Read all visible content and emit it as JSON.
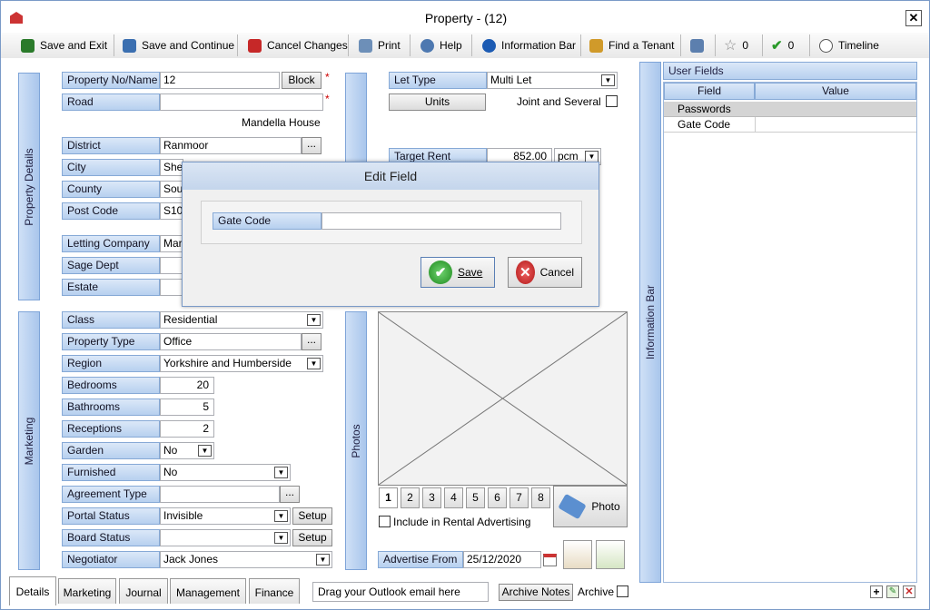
{
  "window": {
    "title": "Property  - (12)",
    "close_glyph": "✕"
  },
  "toolbar": {
    "save_exit": "Save and Exit",
    "save_continue": "Save and Continue",
    "cancel_changes": "Cancel Changes",
    "print": "Print",
    "help": "Help",
    "information_bar": "Information Bar",
    "find_tenant": "Find a Tenant",
    "star_count": "0",
    "tick_count": "0",
    "timeline": "Timeline"
  },
  "side": {
    "property_details": "Property Details",
    "marketing": "Marketing",
    "photos": "Photos",
    "information_bar": "Information Bar"
  },
  "details": {
    "property_no_label": "Property No/Name",
    "property_no": "12",
    "block_btn": "Block",
    "road_label": "Road",
    "road": "",
    "house_name": "Mandella House",
    "district_label": "District",
    "district": "Ranmoor",
    "city_label": "City",
    "city": "Shef",
    "county_label": "County",
    "county": "South",
    "postcode_label": "Post Code",
    "postcode": "S10",
    "letting_company_label": "Letting Company",
    "letting_company": "Mar",
    "sage_dept_label": "Sage Dept",
    "sage_dept": "",
    "estate_label": "Estate",
    "estate": "",
    "dots": "...",
    "required": "*"
  },
  "let": {
    "let_type_label": "Let Type",
    "let_type": "Multi Let",
    "units_btn": "Units",
    "joint_several": "Joint and Several",
    "target_rent_label": "Target Rent",
    "target_rent": "852.00",
    "period": "pcm"
  },
  "marketing": {
    "class_label": "Class",
    "class": "Residential",
    "property_type_label": "Property Type",
    "property_type": "Office",
    "region_label": "Region",
    "region": "Yorkshire and Humberside",
    "bedrooms_label": "Bedrooms",
    "bedrooms": "20",
    "bathrooms_label": "Bathrooms",
    "bathrooms": "5",
    "receptions_label": "Receptions",
    "receptions": "2",
    "garden_label": "Garden",
    "garden": "No",
    "furnished_label": "Furnished",
    "furnished": "No",
    "agreement_type_label": "Agreement Type",
    "agreement_type": "",
    "portal_status_label": "Portal Status",
    "portal_status": "Invisible",
    "board_status_label": "Board Status",
    "board_status": "",
    "negotiator_label": "Negotiator",
    "negotiator": "Jack Jones",
    "setup_btn": "Setup"
  },
  "photos": {
    "pages": [
      "1",
      "2",
      "3",
      "4",
      "5",
      "6",
      "7",
      "8"
    ],
    "photo_btn": "Photo",
    "include_label": "Include in  Rental Advertising",
    "advertise_from_label": "Advertise From",
    "advertise_from": "25/12/2020"
  },
  "tabs": [
    "Details",
    "Marketing",
    "Journal",
    "Management",
    "Finance"
  ],
  "bottom": {
    "outlook_drop": "Drag your Outlook email here",
    "archive_notes": "Archive Notes",
    "archive": "Archive"
  },
  "user_fields": {
    "title": "User Fields",
    "col_field": "Field",
    "col_value": "Value",
    "rows": [
      {
        "field": "Passwords",
        "value": ""
      },
      {
        "field": "Gate Code",
        "value": ""
      }
    ]
  },
  "dialog": {
    "title": "Edit Field",
    "field_label": "Gate Code",
    "field_value": "",
    "save": "Save",
    "cancel": "Cancel"
  }
}
